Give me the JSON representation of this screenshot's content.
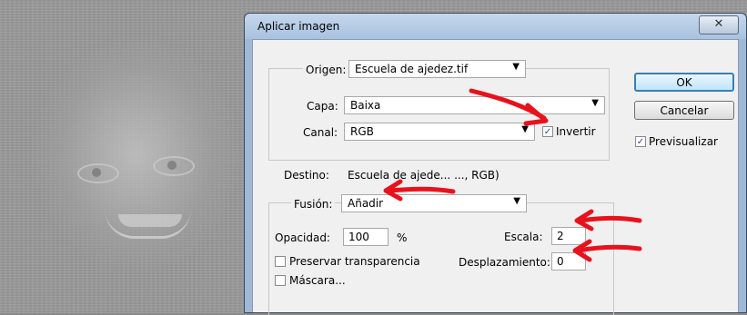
{
  "dialog": {
    "title": "Aplicar imagen",
    "close_glyph": "✕",
    "origen_label": "Origen:",
    "origen_value": "Escuela de ajedez.tif",
    "capa_label": "Capa:",
    "capa_value": "Baixa",
    "canal_label": "Canal:",
    "canal_value": "RGB",
    "invertir_label": "Invertir",
    "invertir_checked": "✓",
    "destino_label": "Destino:",
    "destino_value": "Escuela de ajede... ..., RGB)",
    "fusion_label": "Fusión:",
    "fusion_value": "Añadir",
    "opacidad_label": "Opacidad:",
    "opacidad_value": "100",
    "opacidad_unit": "%",
    "escala_label": "Escala:",
    "escala_value": "2",
    "desplazamiento_label": "Desplazamiento:",
    "desplazamiento_value": "0",
    "preservar_label": "Preservar transparencia",
    "mascara_label": "Máscara...",
    "ok_label": "OK",
    "cancelar_label": "Cancelar",
    "previsualizar_label": "Previsualizar",
    "previsualizar_checked": "✓",
    "chevron": "▼"
  },
  "colors": {
    "annotation_arrow": "#e8121c",
    "default_button_border": "#3c7fb1"
  }
}
